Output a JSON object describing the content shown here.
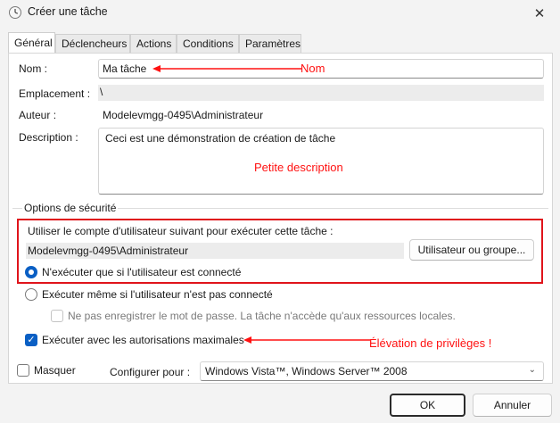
{
  "window": {
    "title": "Créer une tâche",
    "close_symbol": "✕"
  },
  "tabs": [
    {
      "label": "Général"
    },
    {
      "label": "Déclencheurs"
    },
    {
      "label": "Actions"
    },
    {
      "label": "Conditions"
    },
    {
      "label": "Paramètres"
    }
  ],
  "general": {
    "name_label": "Nom :",
    "name_value": "Ma tâche",
    "location_label": "Emplacement :",
    "location_value": "\\",
    "author_label": "Auteur :",
    "author_value": "Modelevmgg-0495\\Administrateur",
    "description_label": "Description :",
    "description_value": "Ceci est une démonstration de création de tâche"
  },
  "annotations": {
    "name": "Nom",
    "description": "Petite description",
    "elevation": "Élévation de privilèges !",
    "color": "#ff1111"
  },
  "security": {
    "group_label": "Options de sécurité",
    "account_prompt": "Utiliser le compte d'utilisateur suivant pour exécuter cette tâche :",
    "account_value": "Modelevmgg-0495\\Administrateur",
    "user_group_button": "Utilisateur ou groupe...",
    "radio_logged_on": "N'exécuter que si l'utilisateur est connecté",
    "radio_logged_on_selected": true,
    "radio_any": "Exécuter même si l'utilisateur n'est pas connecté",
    "no_store_password": "Ne pas enregistrer le mot de passe. La tâche n'accède qu'aux ressources locales.",
    "highest_privileges": "Exécuter avec les autorisations maximales",
    "highest_privileges_checked": true
  },
  "bottom": {
    "hidden_label": "Masquer",
    "configure_label": "Configurer pour :",
    "configure_value": "Windows Vista™, Windows Server™ 2008"
  },
  "buttons": {
    "ok": "OK",
    "cancel": "Annuler"
  },
  "colors": {
    "accent": "#0a5fc4",
    "highlight_box": "#e0141b"
  }
}
